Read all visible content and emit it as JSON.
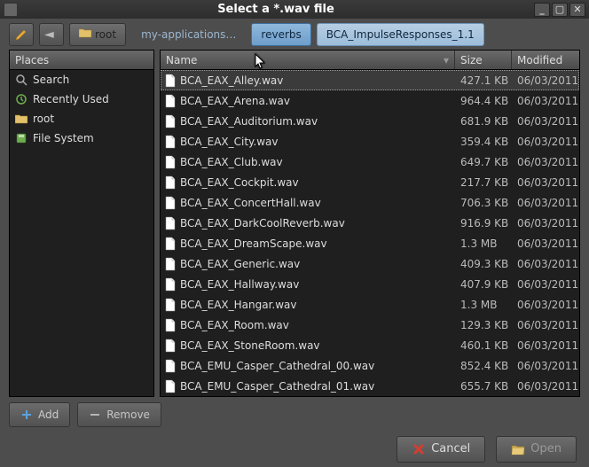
{
  "window": {
    "title": "Select a *.wav file"
  },
  "toolbar": {
    "pencil": "edit",
    "back": "back"
  },
  "breadcrumbs": {
    "root": "root",
    "myapps": "my-applications…",
    "reverbs": "reverbs",
    "bca": "BCA_ImpulseResponses_1.1"
  },
  "places_header": "Places",
  "places": [
    {
      "icon": "search",
      "label": "Search"
    },
    {
      "icon": "recent",
      "label": "Recently Used"
    },
    {
      "icon": "folder",
      "label": "root"
    },
    {
      "icon": "disk",
      "label": "File System"
    }
  ],
  "columns": {
    "name": "Name",
    "size": "Size",
    "modified": "Modified"
  },
  "files": [
    {
      "name": "BCA_EAX_Alley.wav",
      "size": "427.1 KB",
      "mod": "06/03/2011",
      "sel": true
    },
    {
      "name": "BCA_EAX_Arena.wav",
      "size": "964.4 KB",
      "mod": "06/03/2011"
    },
    {
      "name": "BCA_EAX_Auditorium.wav",
      "size": "681.9 KB",
      "mod": "06/03/2011"
    },
    {
      "name": "BCA_EAX_City.wav",
      "size": "359.4 KB",
      "mod": "06/03/2011"
    },
    {
      "name": "BCA_EAX_Club.wav",
      "size": "649.7 KB",
      "mod": "06/03/2011"
    },
    {
      "name": "BCA_EAX_Cockpit.wav",
      "size": "217.7 KB",
      "mod": "06/03/2011"
    },
    {
      "name": "BCA_EAX_ConcertHall.wav",
      "size": "706.3 KB",
      "mod": "06/03/2011"
    },
    {
      "name": "BCA_EAX_DarkCoolReverb.wav",
      "size": "916.9 KB",
      "mod": "06/03/2011"
    },
    {
      "name": "BCA_EAX_DreamScape.wav",
      "size": "1.3 MB",
      "mod": "06/03/2011"
    },
    {
      "name": "BCA_EAX_Generic.wav",
      "size": "409.3 KB",
      "mod": "06/03/2011"
    },
    {
      "name": "BCA_EAX_Hallway.wav",
      "size": "407.9 KB",
      "mod": "06/03/2011"
    },
    {
      "name": "BCA_EAX_Hangar.wav",
      "size": "1.3 MB",
      "mod": "06/03/2011"
    },
    {
      "name": "BCA_EAX_Room.wav",
      "size": "129.3 KB",
      "mod": "06/03/2011"
    },
    {
      "name": "BCA_EAX_StoneRoom.wav",
      "size": "460.1 KB",
      "mod": "06/03/2011"
    },
    {
      "name": "BCA_EMU_Casper_Cathedral_00.wav",
      "size": "852.4 KB",
      "mod": "06/03/2011"
    },
    {
      "name": "BCA_EMU_Casper_Cathedral_01.wav",
      "size": "655.7 KB",
      "mod": "06/03/2011"
    }
  ],
  "sidebar_buttons": {
    "add": "Add",
    "remove": "Remove"
  },
  "footer": {
    "cancel": "Cancel",
    "open": "Open"
  }
}
